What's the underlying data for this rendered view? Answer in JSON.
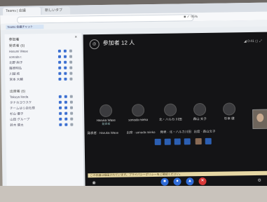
{
  "browser": {
    "tabs": [
      "Teams | 会議",
      "新しいタブ"
    ],
    "address_right": "■ ✓ 95%",
    "bookmark": "Teams 会議チャット"
  },
  "sidebar": {
    "title": "参加者",
    "close": "×",
    "section1": "発表者 (6)",
    "section2": "出席者 (6)",
    "presenters": [
      "Harumi Wase",
      "sonoda r.",
      "北野 絢子",
      "藤原明弘",
      "川越 純",
      "宮本 大輔"
    ],
    "attendees": [
      "Takuya Ikeda",
      "タナカヨウスケ",
      "チームはら会社様",
      "杉山 優子",
      "山田 グループ",
      "鈴木 健太"
    ],
    "role_tag": "(You)",
    "buttons": [
      "出席者を招待",
      "参加者を管理"
    ]
  },
  "meeting": {
    "count_label": "参加者 12 人",
    "top_right": "◢ 0:41 ◻ ⤢",
    "tiles": [
      {
        "name": "Haruka Wase",
        "tag": "発表者"
      },
      {
        "name": "sonoda mieko",
        "tag": ""
      },
      {
        "name": "北・ハルカ 川田",
        "tag": ""
      },
      {
        "name": "森山 文子",
        "tag": ""
      },
      {
        "name": "杉本 健",
        "tag": ""
      }
    ],
    "strip": [
      "発表者 · Haruka Wase",
      "出席 · sonoda mieko",
      "発表 · 北・ハルカ川田",
      "出席 · 森山文子",
      "杉本 健"
    ],
    "notice": "この会議は録画されています。プライバシーポリシーをご確認ください。",
    "controls": [
      "camera-icon",
      "mic-icon",
      "share-icon",
      "hangup-icon"
    ],
    "colors": {
      "accent": "#2f6bd8",
      "hangup": "#d93838",
      "stage": "#141416"
    }
  }
}
